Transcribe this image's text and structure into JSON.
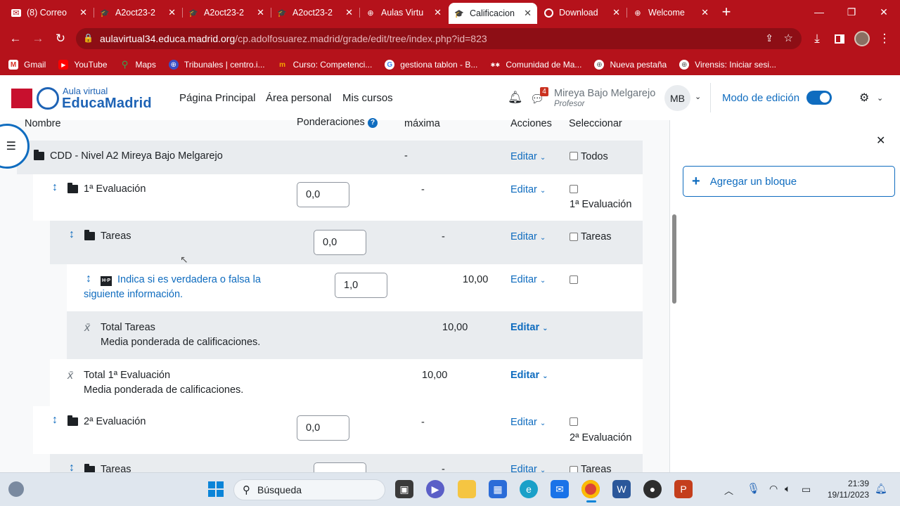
{
  "browser": {
    "tabs": [
      {
        "title": "(8) Correo",
        "icon": "mail-icon",
        "left": 0
      },
      {
        "title": "A2oct23-2",
        "icon": "moodle-cap-icon"
      },
      {
        "title": "A2oct23-2",
        "icon": "moodle-cap-icon"
      },
      {
        "title": "A2oct23-2",
        "icon": "moodle-cap-icon"
      },
      {
        "title": "Aulas Virtu",
        "icon": "globe-icon"
      },
      {
        "title": "Calificacion",
        "icon": "moodle-cap-icon",
        "active": true
      },
      {
        "title": "Download",
        "icon": "chrome-icon"
      },
      {
        "title": "Welcome",
        "icon": "globe-icon"
      }
    ],
    "url_host": "aulavirtual34.educa.madrid.org",
    "url_path": "/cp.adolfosuarez.madrid/grade/edit/tree/index.php?id=823",
    "bookmarks": [
      {
        "label": "Gmail",
        "icon": "gmail-icon"
      },
      {
        "label": "YouTube",
        "icon": "youtube-icon"
      },
      {
        "label": "Maps",
        "icon": "maps-icon"
      },
      {
        "label": "Tribunales | centro.i...",
        "icon": "globe-icon"
      },
      {
        "label": "Curso: Competenci...",
        "icon": "course-icon"
      },
      {
        "label": "gestiona tablon - B...",
        "icon": "google-icon"
      },
      {
        "label": "Comunidad de Ma...",
        "icon": "madrid-icon"
      },
      {
        "label": "Nueva pestaña",
        "icon": "globe-icon"
      },
      {
        "label": "Virensis: Iniciar sesi...",
        "icon": "globe-icon"
      }
    ]
  },
  "header": {
    "logo_line1": "Aula virtual",
    "logo_line2": "EducaMadrid",
    "nav": [
      "Página Principal",
      "Área personal",
      "Mis cursos"
    ],
    "notification_count": "4",
    "user_name": "Mireya Bajo Melgarejo",
    "user_role": "Profesor",
    "avatar_initials": "MB",
    "edit_mode_label": "Modo de edición",
    "accent": "#0f6cbf"
  },
  "table": {
    "headers": {
      "name": "Nombre",
      "weights": "Ponderaciones",
      "max": "máxima",
      "actions": "Acciones",
      "select": "Seleccionar"
    },
    "course": {
      "name": "CDD - Nivel A2 Mireya Bajo Melgarejo",
      "max": "-",
      "action": "Editar",
      "select": "Todos"
    },
    "eval1": {
      "name": "1ª Evaluación",
      "weight": "0,0",
      "max": "-",
      "action": "Editar",
      "select": "1ª Evaluación"
    },
    "tareas1": {
      "name": "Tareas",
      "weight": "0,0",
      "max": "-",
      "action": "Editar",
      "select": "Tareas"
    },
    "item1": {
      "name_line1": "Indica si es verdadera o falsa la",
      "name_line2": "siguiente información.",
      "weight": "1,0",
      "max": "10,00",
      "action": "Editar"
    },
    "total_tareas": {
      "name": "Total Tareas",
      "desc": "Media ponderada de calificaciones.",
      "max": "10,00",
      "action": "Editar"
    },
    "total_eval1": {
      "name": "Total 1ª Evaluación",
      "desc": "Media ponderada de calificaciones.",
      "max": "10,00",
      "action": "Editar"
    },
    "eval2": {
      "name": "2ª Evaluación",
      "weight": "0,0",
      "max": "-",
      "action": "Editar",
      "select": "2ª Evaluación"
    },
    "tareas2": {
      "name": "Tareas",
      "max": "-",
      "action": "Editar",
      "select": "Tareas"
    }
  },
  "blocks": {
    "add_label": "Agregar un bloque"
  },
  "taskbar": {
    "search_placeholder": "Búsqueda",
    "time": "21:39",
    "date": "19/11/2023"
  }
}
